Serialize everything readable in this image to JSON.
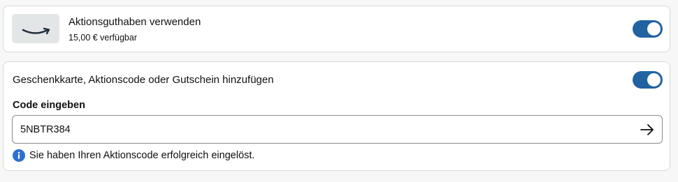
{
  "promo_credit": {
    "logo_icon": "amazon-smile-logo-icon",
    "title": "Aktionsguthaben verwenden",
    "available": "15,00 € verfügbar",
    "toggle_on": true
  },
  "gift_code": {
    "title": "Geschenkkarte, Aktionscode oder Gutschein hinzufügen",
    "toggle_on": true,
    "code_label": "Code eingeben",
    "code_value": "5NBTR384",
    "submit_icon": "arrow-right-icon",
    "info_icon": "info-icon",
    "success_message": "Sie haben Ihren Aktionscode erfolgreich eingelöst."
  },
  "colors": {
    "toggle_active": "#2162a1",
    "info_blue": "#2f6fd0",
    "border": "#d5d9d9"
  }
}
